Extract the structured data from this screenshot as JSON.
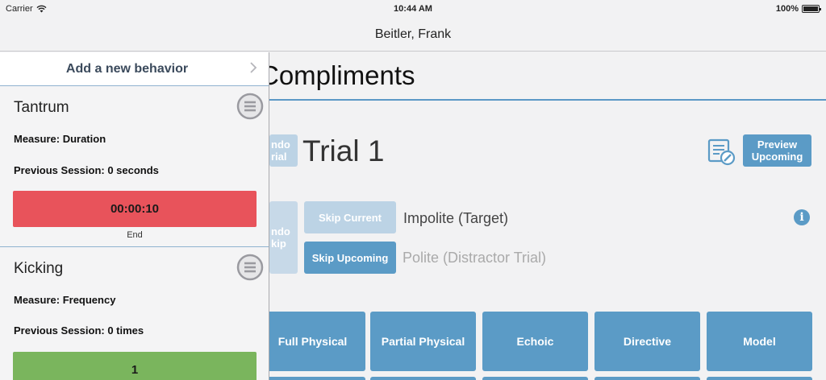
{
  "status_bar": {
    "carrier": "Carrier",
    "time": "10:44 AM",
    "battery": "100%"
  },
  "nav": {
    "title": "Beitler, Frank"
  },
  "main": {
    "section_title": "Compliments",
    "undo_trial_label": "ndo\nrial",
    "trial_title": "Trial 1",
    "preview_upcoming_label": "Preview\nUpcoming",
    "undo_skip_label": "ndo\nkip",
    "skip_current_label": "Skip Current",
    "skip_upcoming_label": "Skip Upcoming",
    "target_text": "Impolite (Target)",
    "distractor_text": "Polite (Distractor Trial)",
    "prompt_buttons": [
      "Full Physical",
      "Partial Physical",
      "Echoic",
      "Directive",
      "Model"
    ]
  },
  "panel": {
    "add_behavior_label": "Add a new behavior",
    "behaviors": [
      {
        "name": "Tantrum",
        "measure": "Measure: Duration",
        "previous": "Previous Session: 0 seconds",
        "button_value": "00:00:10",
        "button_caption": "End"
      },
      {
        "name": "Kicking",
        "measure": "Measure: Frequency",
        "previous": "Previous Session: 0 times",
        "button_value": "1"
      }
    ]
  },
  "colors": {
    "accent_blue": "#5b9bc6",
    "duration_red": "#e8535b",
    "frequency_green": "#7ab55d"
  }
}
